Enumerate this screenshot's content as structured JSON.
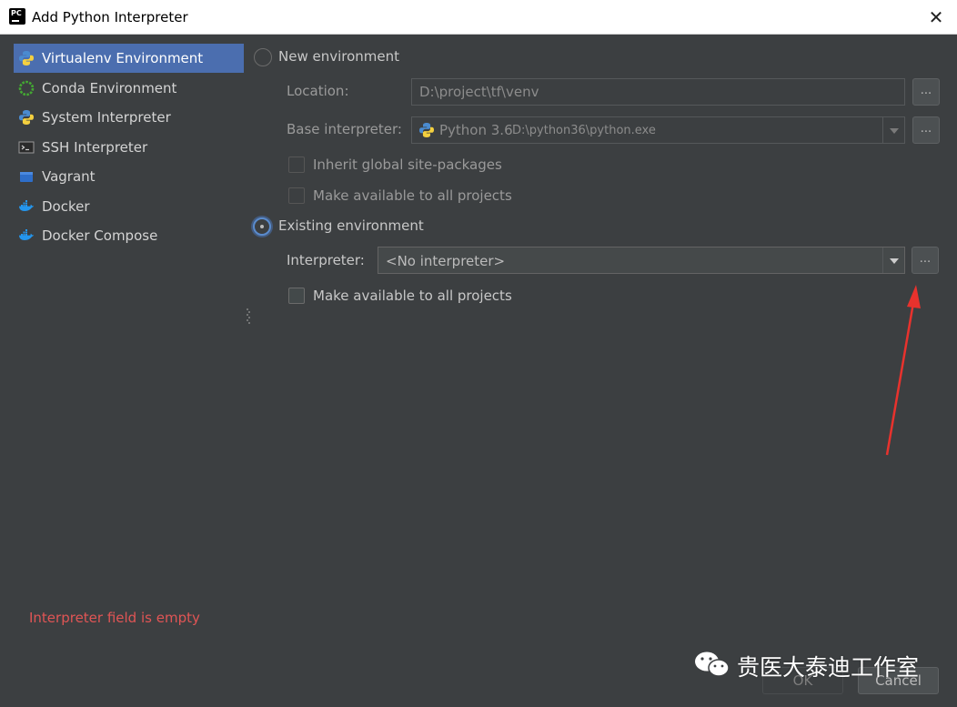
{
  "window": {
    "title": "Add Python Interpreter",
    "close_glyph": "✕"
  },
  "sidebar": {
    "items": [
      {
        "label": "Virtualenv Environment",
        "icon": "python-icon",
        "selected": true
      },
      {
        "label": "Conda Environment",
        "icon": "conda-icon",
        "selected": false
      },
      {
        "label": "System Interpreter",
        "icon": "python-icon",
        "selected": false
      },
      {
        "label": "SSH Interpreter",
        "icon": "terminal-icon",
        "selected": false
      },
      {
        "label": "Vagrant",
        "icon": "vagrant-icon",
        "selected": false
      },
      {
        "label": "Docker",
        "icon": "docker-icon",
        "selected": false
      },
      {
        "label": "Docker Compose",
        "icon": "docker-icon",
        "selected": false
      }
    ]
  },
  "new_env": {
    "label": "New environment",
    "selected": false,
    "location_label": "Location:",
    "location_value": "D:\\project\\tf\\venv",
    "base_label": "Base interpreter:",
    "base_value_name": "Python 3.6",
    "base_value_path": "D:\\python36\\python.exe",
    "inherit_label": "Inherit global site-packages",
    "make_available_label": "Make available to all projects"
  },
  "existing_env": {
    "label": "Existing environment",
    "selected": true,
    "interpreter_label": "Interpreter:",
    "interpreter_value": "<No interpreter>",
    "make_available_label": "Make available to all projects"
  },
  "browse_label": "...",
  "error_text": "Interpreter field is empty",
  "buttons": {
    "ok": "OK",
    "cancel": "Cancel"
  },
  "watermark": {
    "text": "贵医大泰迪工作室"
  },
  "colors": {
    "background": "#3c3f41",
    "selection": "#4b6eaf",
    "error": "#e05555",
    "annotation_arrow": "#e8322d"
  }
}
